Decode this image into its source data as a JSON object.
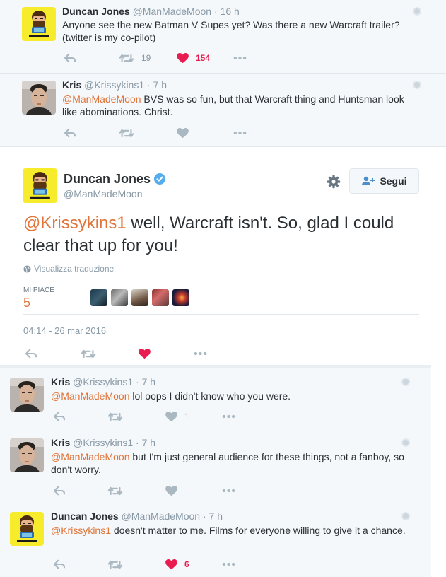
{
  "ancestors": [
    {
      "name": "Duncan Jones",
      "handle": "@ManMadeMoon",
      "time": "· 16 h",
      "text": "Anyone see the new Batman V Supes yet?  Was there a new Warcraft trailer? (twitter is my co-pilot)",
      "retweets": "19",
      "likes": "154",
      "liked": true,
      "avatar_caption": "MANMADEMOON"
    },
    {
      "name": "Kris",
      "handle": "@Krissykins1",
      "time": "· 7 h",
      "mention": "@ManMadeMoon",
      "text": " BVS was so fun, but that Warcraft thing and Huntsman look like abominations. Christ.",
      "retweets": "",
      "likes": "",
      "liked": false
    }
  ],
  "main": {
    "name": "Duncan Jones",
    "verified_icon": "verified-badge-icon",
    "handle": "@ManMadeMoon",
    "follow_label": "Segui",
    "mention": "@Krissykins1",
    "text": " well, Warcraft isn't.  So, glad I could clear that up for you!",
    "translate_label": "Visualizza traduzione",
    "likes_label": "MI PIACE",
    "likes_count": "5",
    "timestamp": "04:14 - 26 mar 2016",
    "avatar_caption": "MANMADEMOON",
    "liked": true
  },
  "replies": [
    {
      "name": "Kris",
      "handle": "@Krissykins1",
      "time": "· 7 h",
      "mention": "@ManMadeMoon",
      "text": " lol oops I didn't know who you were.",
      "retweets": "",
      "likes": "1",
      "liked": false
    },
    {
      "name": "Kris",
      "handle": "@Krissykins1",
      "time": "· 7 h",
      "mention": "@ManMadeMoon",
      "text": " but I'm just general audience for these things, not a fanboy, so don't worry.",
      "retweets": "",
      "likes": "",
      "liked": false
    },
    {
      "name": "Duncan Jones",
      "handle": "@ManMadeMoon",
      "time": "· 7 h",
      "mention": "@Krissykins1",
      "text": " doesn't matter to me.  Films for everyone willing to give it a chance.",
      "retweets": "",
      "likes": "6",
      "liked": true,
      "avatar_caption": "MANMADEMOON"
    }
  ],
  "colors": {
    "accent": "#e0743a",
    "like_red": "#e81c4f",
    "verified_blue": "#55acee",
    "follow_blue": "#4d8fca",
    "muted": "#8899a6"
  }
}
